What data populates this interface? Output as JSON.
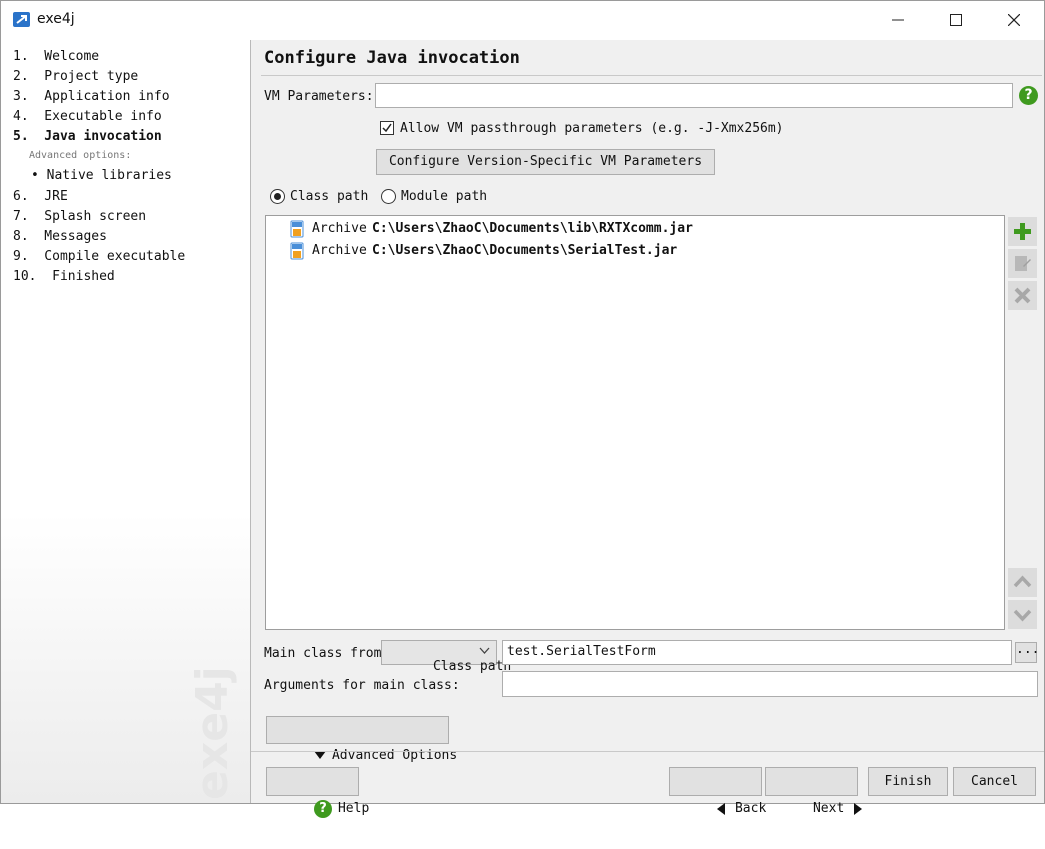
{
  "window": {
    "title": "exe4j"
  },
  "sidebar": {
    "steps": [
      {
        "label": "1.  Welcome"
      },
      {
        "label": "2.  Project type"
      },
      {
        "label": "3.  Application info"
      },
      {
        "label": "4.  Executable info"
      },
      {
        "label": "5.  Java invocation"
      },
      {
        "label": "6.  JRE"
      },
      {
        "label": "7.  Splash screen"
      },
      {
        "label": "8.  Messages"
      },
      {
        "label": "9.  Compile executable"
      },
      {
        "label": "10.  Finished"
      }
    ],
    "advanced_label": "Advanced options:",
    "sub_step": "• Native libraries",
    "watermark": "exe4j"
  },
  "main": {
    "title": "Configure Java invocation",
    "vm_parameters": {
      "label": "VM Parameters:",
      "value": ""
    },
    "allow_passthrough": {
      "label": "Allow VM passthrough parameters (e.g. -J-Xmx256m)",
      "checked": true
    },
    "configure_button": "Configure Version-Specific VM Parameters",
    "path_mode": {
      "class_path": "Class path",
      "module_path": "Module path",
      "selected": "Class path"
    },
    "classpath_entries": [
      {
        "kind": "Archive",
        "path": "C:\\Users\\ZhaoC\\Documents\\lib\\RXTXcomm.jar"
      },
      {
        "kind": "Archive",
        "path": "C:\\Users\\ZhaoC\\Documents\\SerialTest.jar"
      }
    ],
    "main_class": {
      "label": "Main class from",
      "source": "Class path",
      "value": "test.SerialTestForm",
      "browse": "..."
    },
    "arguments": {
      "label": "Arguments for main class:",
      "value": ""
    },
    "advanced_button": "Advanced Options"
  },
  "footer": {
    "help": "Help",
    "back": "Back",
    "next": "Next",
    "finish": "Finish",
    "cancel": "Cancel"
  },
  "colors": {
    "accent_green": "#3f9a1f",
    "jar_orange": "#f0a020",
    "jar_blue": "#4a8fd8"
  }
}
